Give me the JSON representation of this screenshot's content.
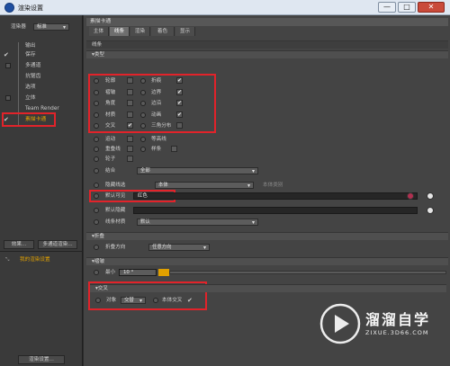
{
  "window": {
    "title": "渲染设置",
    "buttons": [
      "—",
      "□",
      "✕"
    ]
  },
  "left": {
    "renderer_label": "渲染器",
    "renderer_value": "标准",
    "items": [
      {
        "label": "输出",
        "checked": false
      },
      {
        "label": "保存",
        "checked": true
      },
      {
        "label": "多通道",
        "checked": false
      },
      {
        "label": "抗锯齿",
        "checked": false
      },
      {
        "label": "选项",
        "checked": false
      },
      {
        "label": "立体",
        "checked": false
      },
      {
        "label": "Team Render",
        "checked": false
      },
      {
        "label": "素描卡通",
        "checked": true
      }
    ],
    "effects_button": "效果...",
    "multipass_button": "多通道渲染...",
    "my_render_settings": "我的渲染设置",
    "render_settings_button": "渲染设置..."
  },
  "right": {
    "panel_title": "素描卡通",
    "tabs": [
      "主体",
      "线条",
      "渲染",
      "着色",
      "显示"
    ],
    "active_tab": "线条",
    "section_lines": "线条",
    "section_type": "▾类型",
    "type_rows": [
      [
        "轮廓",
        "折痕"
      ],
      [
        "褶皱",
        "边界"
      ],
      [
        "角度",
        "边沿"
      ],
      [
        "材质",
        "动画"
      ],
      [
        "交叉",
        "三角分布"
      ]
    ],
    "type_rows_extra": [
      "运动",
      "等高线",
      "重叠线",
      "样条",
      "轮子"
    ],
    "type_rows_extra2": [
      "隐藏线",
      "排除"
    ],
    "combine_label": "结合",
    "combine_value": "全部",
    "hidden_label": "隐藏线选",
    "hidden_value": "本体",
    "hidden_note": "本体类别",
    "default_visible_label": "默认可见",
    "default_visible_value": "红色",
    "default_hidden_label": "默认隐藏",
    "line_material_label": "线条材质",
    "line_material_value": "默认",
    "section_fold": "▾折叠",
    "fold_direction_label": "折叠方向",
    "fold_direction_value": "任意方向",
    "section_wrinkle": "▾褶皱",
    "min_label": "最小",
    "min_value": "10 °",
    "section_cross": "▾交叉",
    "object_label": "对象",
    "object_value": "交替",
    "self_cross_label": "本体交叉"
  },
  "watermark": {
    "brand": "溜溜自学",
    "url": "ZIXUE.3D66.COM"
  },
  "colors": {
    "highlight_red": "#e2232a",
    "accent_orange": "#e0a000"
  }
}
